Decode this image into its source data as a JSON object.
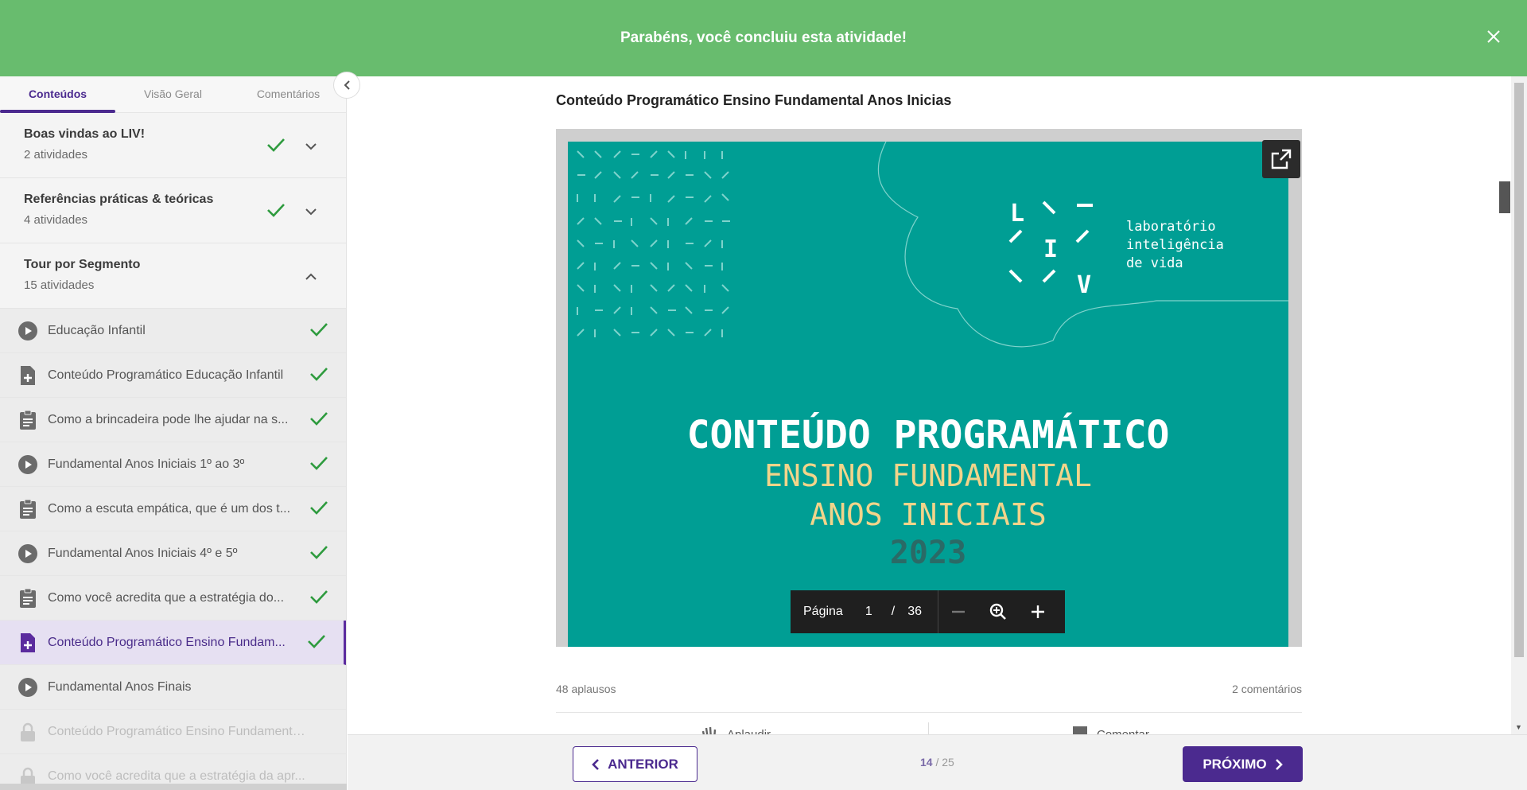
{
  "banner": {
    "message": "Parabéns, você concluiu esta atividade!",
    "close_icon": "×"
  },
  "sidebar": {
    "tabs": [
      {
        "label": "Conteúdos",
        "active": true
      },
      {
        "label": "Visão Geral",
        "active": false
      },
      {
        "label": "Comentários",
        "active": false
      }
    ],
    "sections": [
      {
        "title": "Boas vindas ao LIV!",
        "count": "2 atividades",
        "completed": true,
        "expanded": false
      },
      {
        "title": "Referências práticas & teóricas",
        "count": "4 atividades",
        "completed": true,
        "expanded": false
      },
      {
        "title": "Tour por Segmento",
        "count": "15 atividades",
        "completed": false,
        "expanded": true
      }
    ],
    "items": [
      {
        "label": "Educação Infantil",
        "icon": "play-icon",
        "status": "done"
      },
      {
        "label": "Conteúdo Programático Educação Infantil",
        "icon": "document-add-icon",
        "status": "done"
      },
      {
        "label": "Como a brincadeira pode lhe ajudar na s...",
        "icon": "clipboard-icon",
        "status": "done"
      },
      {
        "label": "Fundamental Anos Iniciais 1º ao 3º",
        "icon": "play-icon",
        "status": "done"
      },
      {
        "label": "Como a escuta empática, que é um dos t...",
        "icon": "clipboard-icon",
        "status": "done"
      },
      {
        "label": "Fundamental Anos Iniciais 4º e 5º",
        "icon": "play-icon",
        "status": "done"
      },
      {
        "label": "Como você acredita que a estratégia do...",
        "icon": "clipboard-icon",
        "status": "done"
      },
      {
        "label": "Conteúdo Programático Ensino Fundam...",
        "icon": "document-add-icon",
        "status": "active"
      },
      {
        "label": "Fundamental Anos Finais",
        "icon": "play-icon",
        "status": "open"
      },
      {
        "label": "Conteúdo Programático Ensino Fundamental...",
        "icon": "lock-icon",
        "status": "locked"
      },
      {
        "label": "Como você acredita que a estratégia da apr...",
        "icon": "lock-icon",
        "status": "locked"
      }
    ]
  },
  "main": {
    "title": "Conteúdo Programático Ensino Fundamental Anos Inicias",
    "slide": {
      "logo_letters": [
        "L",
        "I",
        "V"
      ],
      "logo_text": [
        "laboratório",
        "inteligência",
        "de vida"
      ],
      "heading": "CONTEÚDO PROGRAMÁTICO",
      "subheading_1": "ENSINO FUNDAMENTAL",
      "subheading_2": "ANOS INICIAIS",
      "year": "2023",
      "accent_color": "#009e94",
      "sub_color": "#f2d48a"
    },
    "pager": {
      "label": "Página",
      "current": "1",
      "separator": "/",
      "total": "36"
    },
    "stats": {
      "applause": "48 aplausos",
      "comments": "2 comentários"
    },
    "actions": [
      {
        "label": "Aplaudir",
        "icon": "clap-icon"
      },
      {
        "label": "Comentar",
        "icon": "comment-icon"
      }
    ]
  },
  "footer": {
    "prev_label": "ANTERIOR",
    "next_label": "PRÓXIMO",
    "progress_current": "14",
    "progress_total": "/ 25"
  },
  "colors": {
    "brand": "#4b2a8f",
    "success": "#68bc6e",
    "check": "#2e9b3e"
  }
}
